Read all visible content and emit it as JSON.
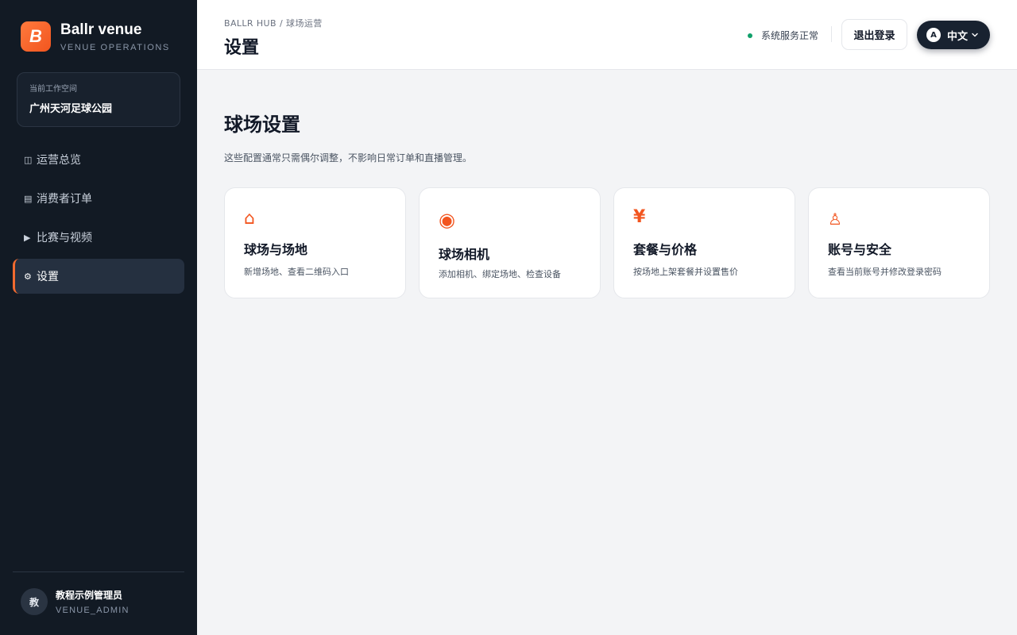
{
  "brand": {
    "logo_letter": "B",
    "name": "Ballr venue",
    "subtitle": "VENUE OPERATIONS"
  },
  "workspace": {
    "label": "当前工作空间",
    "name": "广州天河足球公园"
  },
  "nav": [
    {
      "icon": "◫",
      "icon_name": "dashboard-icon",
      "label": "运营总览",
      "active": false
    },
    {
      "icon": "▤",
      "icon_name": "orders-icon",
      "label": "消费者订单",
      "active": false
    },
    {
      "icon": "▶",
      "icon_name": "play-icon",
      "label": "比赛与视频",
      "active": false
    },
    {
      "icon": "⚙",
      "icon_name": "gear-icon",
      "label": "设置",
      "active": true
    }
  ],
  "user": {
    "avatar_char": "教",
    "name": "教程示例管理员",
    "role": "VENUE_ADMIN"
  },
  "header": {
    "breadcrumb": [
      "BALLR HUB",
      "球场运营"
    ],
    "breadcrumb_sep": "/",
    "title": "设置",
    "status_text": "系统服务正常",
    "status_color": "#10a06a",
    "logout_label": "退出登录",
    "lang_badge": "A",
    "lang_label": "中文"
  },
  "main": {
    "title": "球场设置",
    "description": "这些配置通常只需偶尔调整，不影响日常订单和直播管理。",
    "cards": [
      {
        "icon": "⌂",
        "icon_name": "home-icon",
        "title": "球场与场地",
        "desc": "新增场地、查看二维码入口"
      },
      {
        "icon": "◉",
        "icon_name": "camera-icon",
        "title": "球场相机",
        "desc": "添加相机、绑定场地、检查设备"
      },
      {
        "icon": "¥",
        "icon_name": "yen-icon",
        "title": "套餐与价格",
        "desc": "按场地上架套餐并设置售价"
      },
      {
        "icon": "♙",
        "icon_name": "user-icon",
        "title": "账号与安全",
        "desc": "查看当前账号并修改登录密码"
      }
    ]
  },
  "accent_color": "#f2551f"
}
